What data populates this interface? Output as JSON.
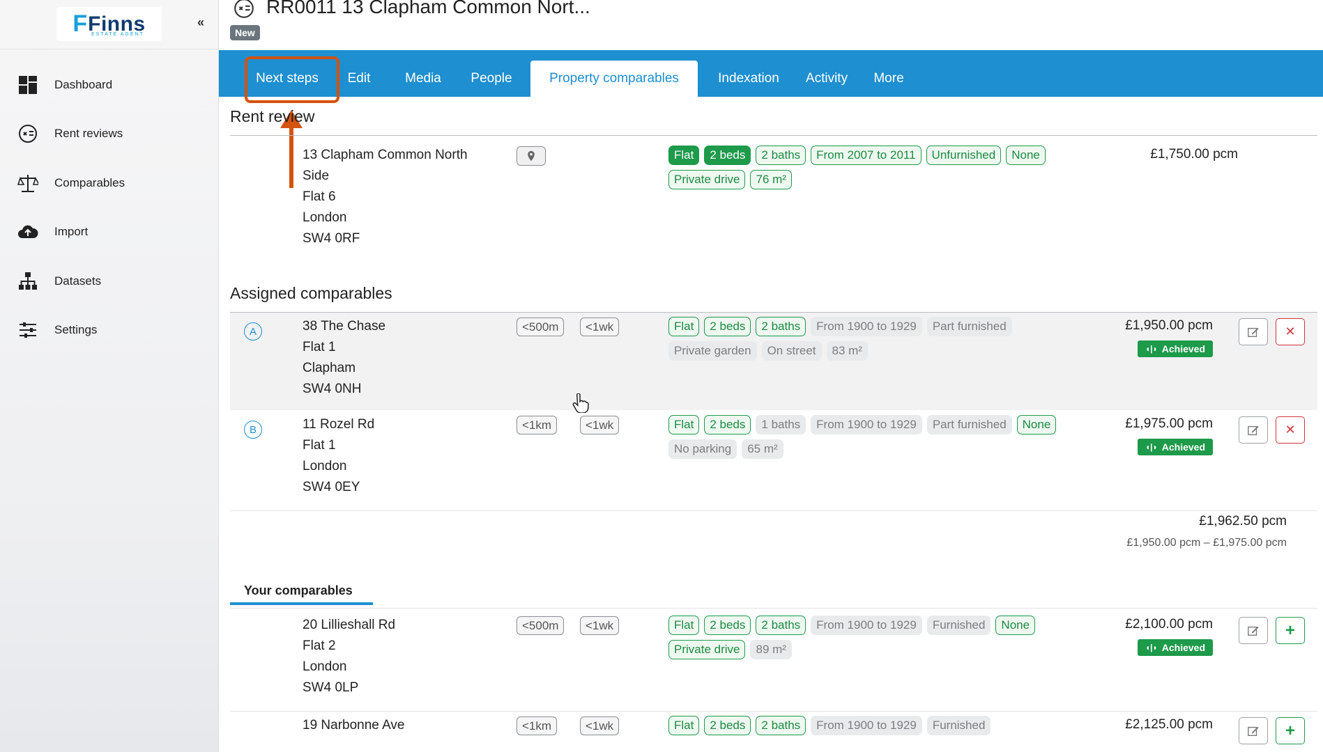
{
  "sidebar": {
    "logo_text": "Finns",
    "logo_sub": "ESTATE AGENT",
    "collapse_label": "«",
    "items": [
      {
        "label": "Dashboard",
        "icon": "dashboard-icon"
      },
      {
        "label": "Rent reviews",
        "icon": "rent-reviews-icon"
      },
      {
        "label": "Comparables",
        "icon": "scales-icon"
      },
      {
        "label": "Import",
        "icon": "cloud-upload-icon"
      },
      {
        "label": "Datasets",
        "icon": "hierarchy-icon"
      },
      {
        "label": "Settings",
        "icon": "sliders-icon"
      }
    ]
  },
  "header": {
    "title": "RR0011 13 Clapham Common Nort...",
    "status_badge": "New"
  },
  "tabs": [
    "Next steps",
    "Edit",
    "Media",
    "People",
    "Property comparables",
    "Indexation",
    "Activity",
    "More"
  ],
  "active_tab": "Property comparables",
  "colors": {
    "primary": "#1e8fd0",
    "success": "#1d9a4a",
    "danger": "#d2343a",
    "highlight": "#d4530f"
  },
  "rent_review": {
    "title": "Rent review",
    "address": [
      "13 Clapham Common North",
      "Side",
      "Flat 6",
      "London",
      "SW4 0RF"
    ],
    "tags": [
      {
        "text": "Flat",
        "style": "filled"
      },
      {
        "text": "2 beds",
        "style": "filled"
      },
      {
        "text": "2 baths",
        "style": "outline"
      },
      {
        "text": "From 2007 to 2011",
        "style": "outline"
      },
      {
        "text": "Unfurnished",
        "style": "outline"
      },
      {
        "text": "None",
        "style": "outline"
      },
      {
        "text": "Private drive",
        "style": "outline"
      },
      {
        "text": "76 m²",
        "style": "outline"
      }
    ],
    "price": "£1,750.00 pcm"
  },
  "assigned": {
    "title": "Assigned comparables",
    "items": [
      {
        "letter": "A",
        "address": [
          "38 The Chase",
          "Flat 1",
          "Clapham",
          "SW4 0NH"
        ],
        "distance": "<500m",
        "age": "<1wk",
        "tags": [
          {
            "text": "Flat",
            "style": "outline"
          },
          {
            "text": "2 beds",
            "style": "outline"
          },
          {
            "text": "2 baths",
            "style": "outline"
          },
          {
            "text": "From 1900 to 1929",
            "style": "plain"
          },
          {
            "text": "Part furnished",
            "style": "plain"
          },
          {
            "text": "Private garden",
            "style": "plain"
          },
          {
            "text": "On street",
            "style": "plain"
          },
          {
            "text": "83 m²",
            "style": "plain"
          }
        ],
        "price": "£1,950.00 pcm",
        "status": "Achieved"
      },
      {
        "letter": "B",
        "address": [
          "11 Rozel Rd",
          "Flat 1",
          "London",
          "SW4 0EY"
        ],
        "distance": "<1km",
        "age": "<1wk",
        "tags": [
          {
            "text": "Flat",
            "style": "outline"
          },
          {
            "text": "2 beds",
            "style": "outline"
          },
          {
            "text": "1 baths",
            "style": "plain"
          },
          {
            "text": "From 1900 to 1929",
            "style": "plain"
          },
          {
            "text": "Part furnished",
            "style": "plain"
          },
          {
            "text": "None",
            "style": "outline"
          },
          {
            "text": "No parking",
            "style": "plain"
          },
          {
            "text": "65 m²",
            "style": "plain"
          }
        ],
        "price": "£1,975.00 pcm",
        "status": "Achieved"
      }
    ],
    "summary": {
      "average": "£1,962.50 pcm",
      "range": "£1,950.00 pcm – £1,975.00 pcm"
    }
  },
  "your_comparables": {
    "tab_label": "Your comparables",
    "items": [
      {
        "address": [
          "20 Lillieshall Rd",
          "Flat 2",
          "London",
          "SW4 0LP"
        ],
        "distance": "<500m",
        "age": "<1wk",
        "tags": [
          {
            "text": "Flat",
            "style": "outline"
          },
          {
            "text": "2 beds",
            "style": "outline"
          },
          {
            "text": "2 baths",
            "style": "outline"
          },
          {
            "text": "From 1900 to 1929",
            "style": "plain"
          },
          {
            "text": "Furnished",
            "style": "plain"
          },
          {
            "text": "None",
            "style": "outline"
          },
          {
            "text": "Private drive",
            "style": "outline"
          },
          {
            "text": "89 m²",
            "style": "plain"
          }
        ],
        "price": "£2,100.00 pcm",
        "status": "Achieved"
      },
      {
        "address": [
          "19 Narbonne Ave"
        ],
        "distance": "<1km",
        "age": "<1wk",
        "tags": [
          {
            "text": "Flat",
            "style": "outline"
          },
          {
            "text": "2 beds",
            "style": "outline"
          },
          {
            "text": "2 baths",
            "style": "outline"
          },
          {
            "text": "From 1900 to 1929",
            "style": "plain"
          },
          {
            "text": "Furnished",
            "style": "plain"
          }
        ],
        "price": "£2,125.00 pcm"
      }
    ]
  }
}
